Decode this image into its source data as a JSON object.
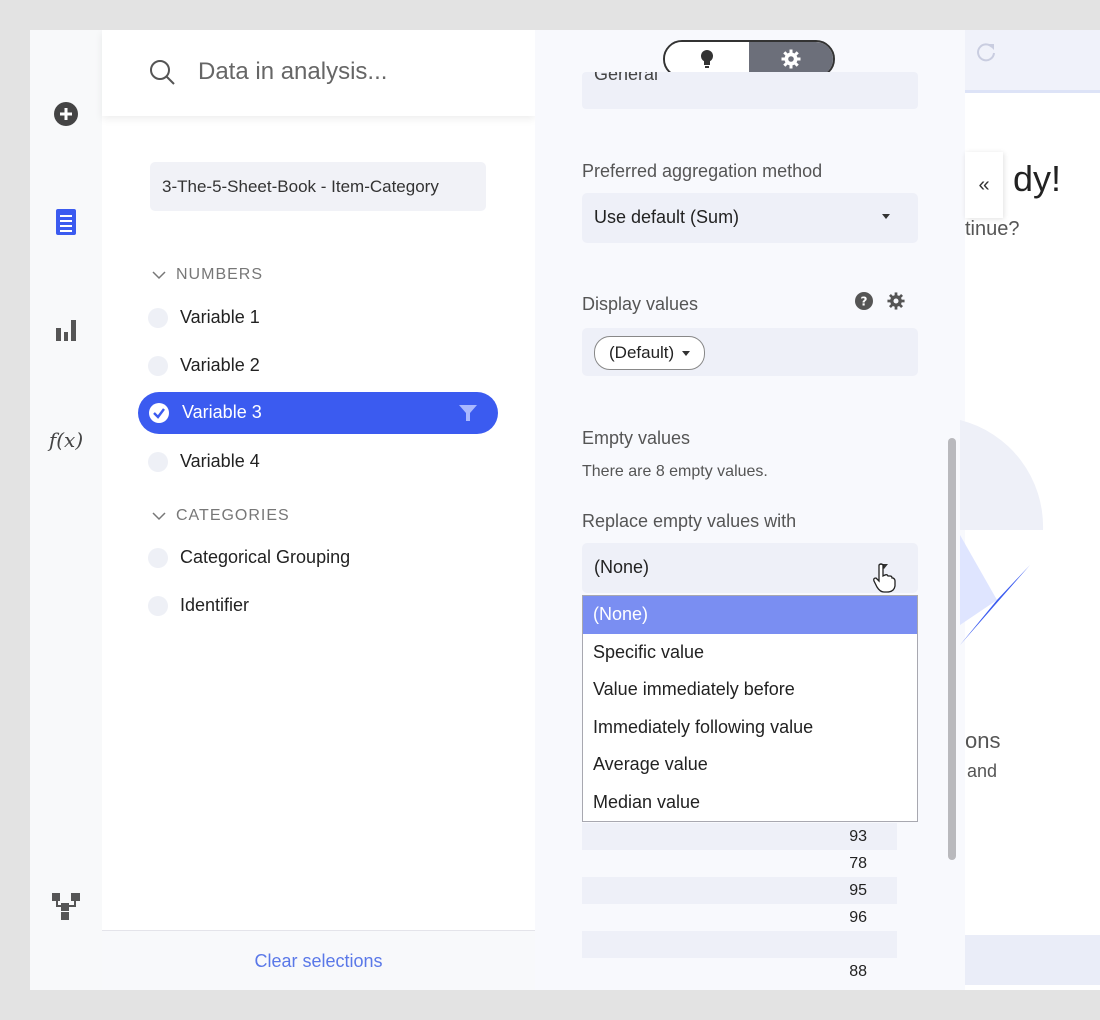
{
  "search": {
    "placeholder": "Data in analysis..."
  },
  "source": {
    "name": "3-The-5-Sheet-Book - Item-Category"
  },
  "groups": {
    "numbers": {
      "label": "NUMBERS"
    },
    "categories": {
      "label": "CATEGORIES"
    }
  },
  "variables": [
    {
      "label": "Variable 1"
    },
    {
      "label": "Variable 2"
    },
    {
      "label": "Variable 3",
      "selected": true
    },
    {
      "label": "Variable 4"
    }
  ],
  "category_items": [
    {
      "label": "Categorical Grouping"
    },
    {
      "label": "Identifier"
    }
  ],
  "footer": {
    "clear_label": "Clear selections"
  },
  "settings": {
    "general_value": "General",
    "aggregation": {
      "label": "Preferred aggregation method",
      "value": "Use default (Sum)"
    },
    "display_values": {
      "label": "Display values",
      "value": "(Default)"
    },
    "empty_values": {
      "label": "Empty values",
      "note": "There are 8 empty values."
    },
    "replace": {
      "label": "Replace empty values with",
      "value": "(None)",
      "options": [
        "(None)",
        "Specific value",
        "Value immediately before",
        "Immediately following value",
        "Average value",
        "Median value"
      ]
    },
    "values": [
      "93",
      "78",
      "95",
      "96",
      "",
      "88"
    ]
  },
  "background": {
    "heading_fragment": "dy!",
    "sub_fragment": "tinue?",
    "ons_fragment": "ons",
    "and_fragment": "and",
    "collapse_glyph": "«"
  },
  "colors": {
    "accent": "#3b5bf0",
    "highlight": "#7a8ef2",
    "link": "#5a78e8"
  }
}
